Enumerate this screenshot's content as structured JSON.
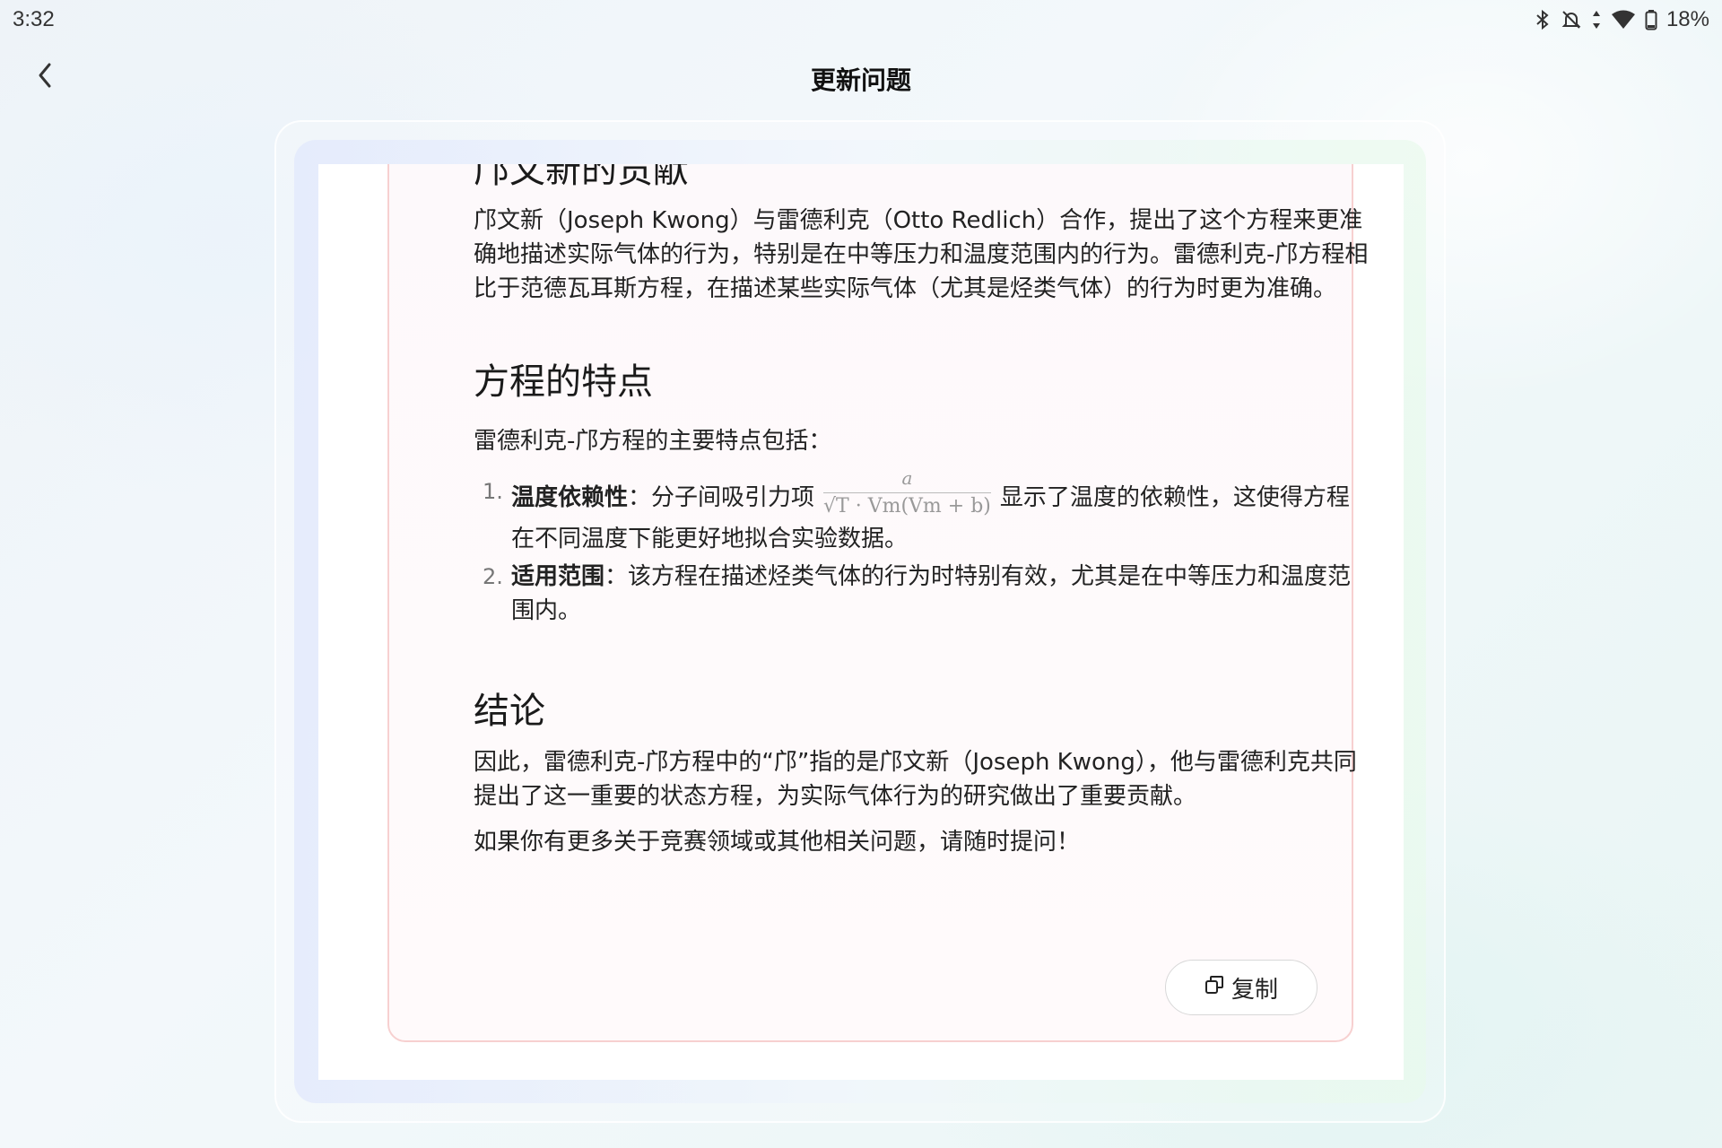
{
  "status_bar": {
    "time": "3:32",
    "battery": "18%",
    "icons": [
      "bluetooth-icon",
      "mute-icon",
      "data-arrows-icon",
      "wifi-icon",
      "battery-icon"
    ]
  },
  "header": {
    "title": "更新问题",
    "back_icon": "chevron-left-icon"
  },
  "content": {
    "section1_heading": "邝文新的贡献",
    "section1_para": "邝文新（Joseph Kwong）与雷德利克（Otto Redlich）合作，提出了这个方程来更准确地描述实际气体的行为，特别是在中等压力和温度范围内的行为。雷德利克-邝方程相比于范德瓦耳斯方程，在描述某些实际气体（尤其是烃类气体）的行为时更为准确。",
    "section2_heading": "方程的特点",
    "section2_intro": "雷德利克-邝方程的主要特点包括：",
    "list": [
      {
        "num": "1.",
        "title": "温度依赖性",
        "text_before": "：分子间吸引力项",
        "formula_numerator": "a",
        "formula_denominator": "√T · Vm(Vm + b)",
        "text_after": "显示了温度的依赖性，这使得方程在不同温度下能更好地拟合实验数据。"
      },
      {
        "num": "2.",
        "title": "适用范围",
        "text": "：该方程在描述烃类气体的行为时特别有效，尤其是在中等压力和温度范围内。"
      }
    ],
    "section3_heading": "结论",
    "section3_para": "因此，雷德利克-邝方程中的“邝”指的是邝文新（Joseph Kwong），他与雷德利克共同提出了这一重要的状态方程，为实际气体行为的研究做出了重要贡献。",
    "closing": "如果你有更多关于竞赛领域或其他相关问题，请随时提问！"
  },
  "actions": {
    "copy_label": "复制",
    "copy_icon": "copy-icon"
  }
}
